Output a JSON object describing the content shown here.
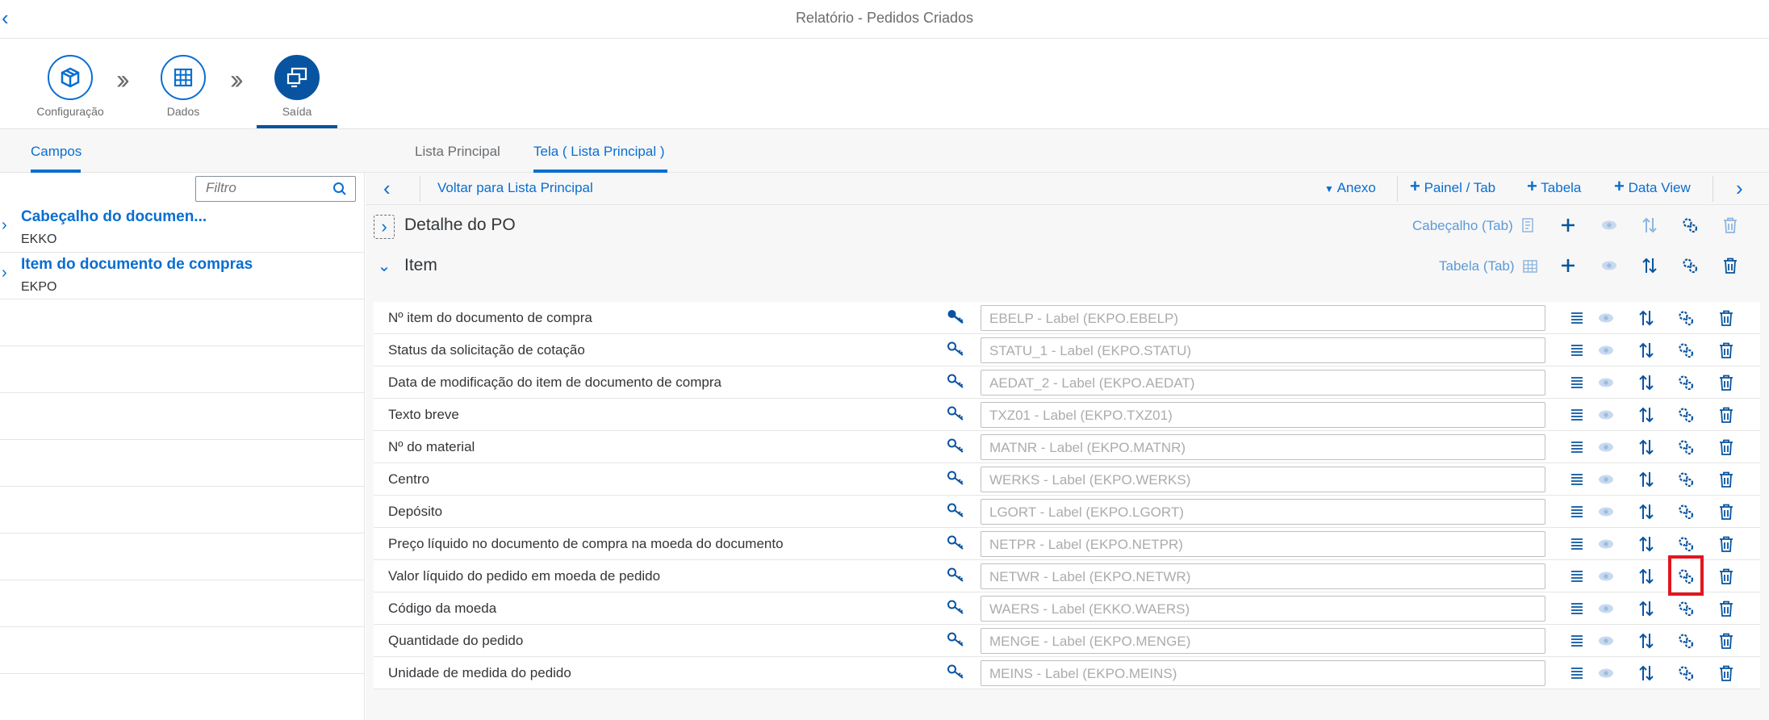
{
  "header": {
    "back_icon": "chevron-left-icon",
    "title": "Relatório - Pedidos Criados"
  },
  "steps": [
    {
      "label": "Configuração",
      "icon": "box-icon"
    },
    {
      "label": "Dados",
      "icon": "grid-icon"
    },
    {
      "label": "Saída",
      "icon": "screens-icon",
      "active": true
    }
  ],
  "tabs": {
    "left": "Campos",
    "middle": "Lista Principal",
    "right": "Tela ( Lista Principal )"
  },
  "left": {
    "filter_placeholder": "Filtro",
    "nodes": [
      {
        "title": "Cabeçalho do documen...",
        "sub": "EKKO"
      },
      {
        "title": "Item do documento de compras",
        "sub": "EKPO"
      }
    ]
  },
  "toolbar": {
    "back_label": "Voltar para Lista Principal",
    "anexo": "Anexo",
    "painel": "Painel / Tab",
    "tabela": "Tabela",
    "dataview": "Data View"
  },
  "sections": [
    {
      "title": "Detalhe do PO",
      "type": "Cabeçalho (Tab)",
      "expanded": false
    },
    {
      "title": "Item",
      "type": "Tabela (Tab)",
      "expanded": true
    }
  ],
  "fields": [
    {
      "label": "Nº item do documento de compra",
      "value": "EBELP - Label (EKPO.EBELP)",
      "key": true
    },
    {
      "label": "Status da solicitação de cotação",
      "value": "STATU_1 - Label (EKPO.STATU)"
    },
    {
      "label": "Data de modificação do item de documento de compra",
      "value": "AEDAT_2 - Label (EKPO.AEDAT)"
    },
    {
      "label": "Texto breve",
      "value": "TXZ01 - Label (EKPO.TXZ01)"
    },
    {
      "label": "Nº do material",
      "value": "MATNR - Label (EKPO.MATNR)"
    },
    {
      "label": "Centro",
      "value": "WERKS - Label (EKPO.WERKS)"
    },
    {
      "label": "Depósito",
      "value": "LGORT - Label (EKPO.LGORT)"
    },
    {
      "label": "Preço líquido no documento de compra na moeda do documento",
      "value": "NETPR - Label (EKPO.NETPR)"
    },
    {
      "label": "Valor líquido do pedido em moeda de pedido",
      "value": "NETWR - Label (EKPO.NETWR)",
      "highlight": true
    },
    {
      "label": "Código da moeda",
      "value": "WAERS - Label (EKKO.WAERS)"
    },
    {
      "label": "Quantidade do pedido",
      "value": "MENGE - Label (EKPO.MENGE)"
    },
    {
      "label": "Unidade de medida do pedido",
      "value": "MEINS - Label (EKPO.MEINS)"
    }
  ],
  "colors": {
    "accent": "#0a6ed1",
    "dark_accent": "#0854a0",
    "highlight": "#e0171f"
  }
}
